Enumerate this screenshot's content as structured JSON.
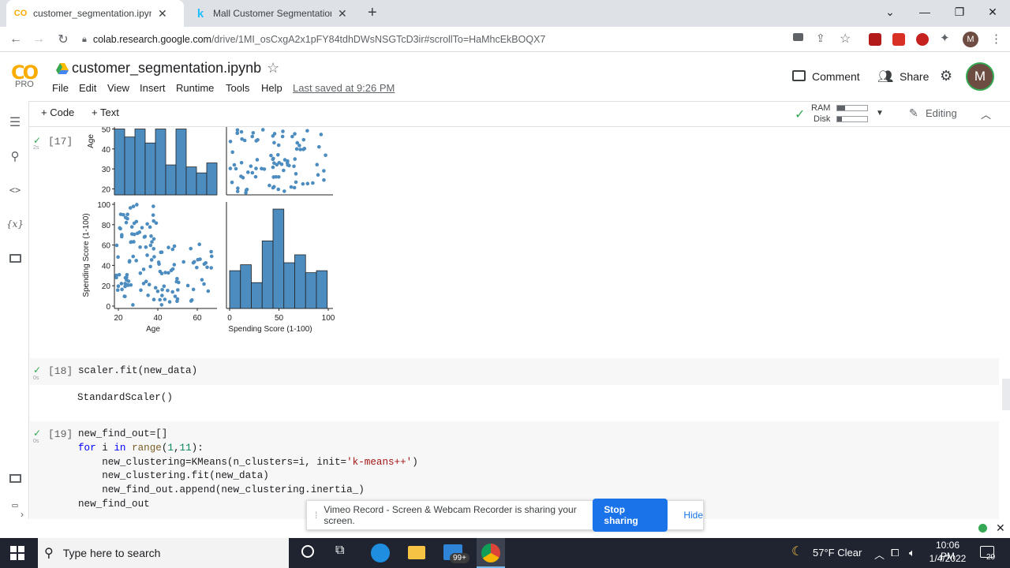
{
  "browser": {
    "tabs": [
      {
        "title": "customer_segmentation.ipynb - C",
        "icon": "colab-icon"
      },
      {
        "title": "Mall Customer Segmentation Da",
        "icon": "kaggle-icon"
      }
    ],
    "new_tab": "+",
    "url_host": "colab.research.google.com",
    "url_path": "/drive/1MI_osCxgA2x1pFY84tdhDWsNSGTcD3ir#scrollTo=HaMhcEkBOQX7",
    "profile_initial": "M"
  },
  "colab": {
    "logo_text": "CO",
    "tier": "PRO",
    "notebook_title": "customer_segmentation.ipynb",
    "menu": [
      "File",
      "Edit",
      "View",
      "Insert",
      "Runtime",
      "Tools",
      "Help"
    ],
    "last_saved": "Last saved at 9:26 PM",
    "comment_label": "Comment",
    "share_label": "Share",
    "avatar_initial": "M",
    "toolbar": {
      "add_code": "+ Code",
      "add_text": "+ Text",
      "ram": "RAM",
      "disk": "Disk",
      "editing": "Editing",
      "ram_fill": 0.25,
      "disk_fill": 0.15
    }
  },
  "cells": [
    {
      "run": "[17]",
      "elapsed": "2s"
    },
    {
      "run": "[18]",
      "elapsed": "0s",
      "code": "scaler.fit(new_data)",
      "output": "StandardScaler()"
    },
    {
      "run": "[19]",
      "elapsed": "0s"
    }
  ],
  "chart_data": [
    {
      "type": "bar",
      "position": "row1-col1",
      "ylabel": "Age",
      "ytick_labels": [
        "20",
        "30",
        "40",
        "50"
      ],
      "values": [
        50,
        46,
        50,
        43,
        50,
        32,
        50,
        31,
        28,
        33
      ]
    },
    {
      "type": "scatter",
      "position": "row1-col2"
    },
    {
      "type": "scatter",
      "position": "row2-col1",
      "xlabel": "Age",
      "ylabel": "Spending Score (1-100)",
      "xtick_labels": [
        "20",
        "40",
        "60"
      ],
      "ytick_labels": [
        "0",
        "20",
        "40",
        "60",
        "80",
        "100"
      ],
      "xlim": [
        18,
        70
      ],
      "ylim": [
        0,
        100
      ]
    },
    {
      "type": "bar",
      "position": "row2-col2",
      "xlabel": "Spending Score (1-100)",
      "xtick_labels": [
        "0",
        "50",
        "100"
      ],
      "values": [
        19,
        22,
        13,
        34,
        50,
        23,
        27,
        18,
        19
      ],
      "bins": [
        0,
        11,
        22,
        33,
        44,
        55,
        66,
        77,
        88,
        99
      ]
    }
  ],
  "notification": {
    "text": "Vimeo Record - Screen & Webcam Recorder is sharing your screen.",
    "stop": "Stop sharing",
    "hide": "Hide"
  },
  "taskbar": {
    "search_placeholder": "Type here to search",
    "weather": "57°F  Clear",
    "time": "10:06 PM",
    "date": "1/4/2022",
    "mail_badge": "99+",
    "notif_count": "20"
  },
  "colors": {
    "accent": "#1a73e8",
    "bar": "#4c8cbf",
    "check": "#34a853"
  }
}
